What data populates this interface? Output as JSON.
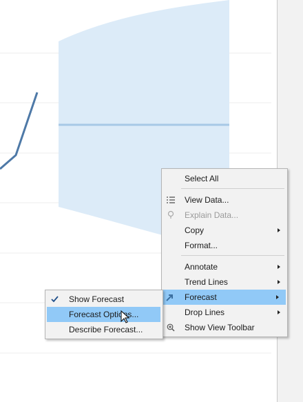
{
  "context_menu": {
    "items": [
      {
        "label": "Select All"
      },
      {
        "label": "View Data...",
        "icon": "table-icon"
      },
      {
        "label": "Explain Data...",
        "icon": "lightbulb-icon",
        "disabled": true
      },
      {
        "label": "Copy",
        "submenu": true
      },
      {
        "label": "Format..."
      },
      {
        "label": "Annotate",
        "submenu": true
      },
      {
        "label": "Trend Lines",
        "submenu": true
      },
      {
        "label": "Forecast",
        "icon": "forecast-icon",
        "submenu": true,
        "highlighted": true
      },
      {
        "label": "Drop Lines",
        "submenu": true
      },
      {
        "label": "Show View Toolbar",
        "icon": "zoom-icon"
      }
    ]
  },
  "forecast_submenu": {
    "items": [
      {
        "label": "Show Forecast",
        "checked": true
      },
      {
        "label": "Forecast Options...",
        "highlighted": true
      },
      {
        "label": "Describe Forecast..."
      }
    ]
  },
  "colors": {
    "line": "#4e79a7",
    "forecast_band": "#dcebf8",
    "forecast_line": "#a7c8e6",
    "highlight": "#91c9f7",
    "menu_bg": "#f2f2f2"
  }
}
